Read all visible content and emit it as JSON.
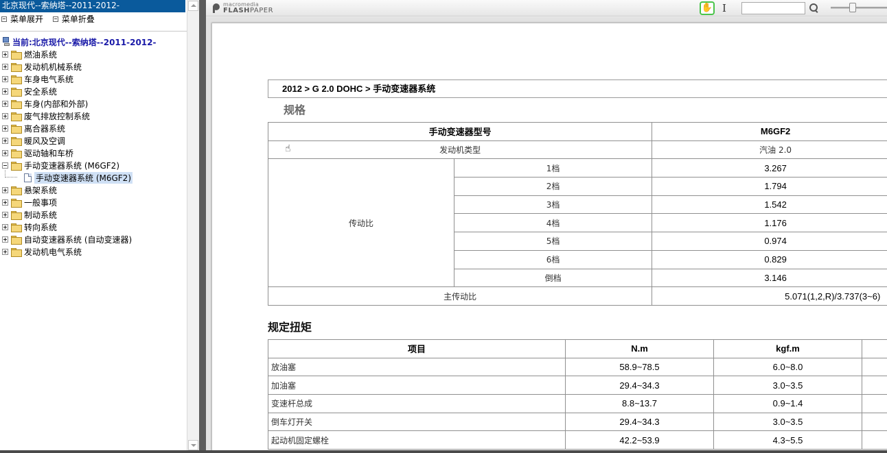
{
  "left": {
    "title": "北京现代--索纳塔--2011-2012-",
    "toolbar": {
      "expand_label": "菜单展开",
      "collapse_label": "菜单折叠"
    },
    "current": "当前:北京现代--索纳塔--2011-2012-",
    "tree": [
      "燃油系统",
      "发动机机械系统",
      "车身电气系统",
      "安全系统",
      "车身(内部和外部)",
      "废气排放控制系统",
      "离合器系统",
      "暖风及空调",
      "驱动轴和车桥",
      "手动变速器系统 (M6GF2)",
      "悬架系统",
      "一般事项",
      "制动系统",
      "转向系统",
      "自动变速器系统 (自动变速器)",
      "发动机电气系统"
    ],
    "selected_child": "手动变速器系统 (M6GF2)"
  },
  "toolbar": {
    "logo_small": "macromedia",
    "logo_big_a": "FLASH",
    "logo_big_b": "PAPER",
    "search_value": ""
  },
  "doc": {
    "breadcrumb": "2012 > G 2.0 DOHC > 手动变速器系统",
    "spec_heading": "规格",
    "spec": {
      "header_left": "手动变速器型号",
      "header_right": "M6GF2",
      "engine_label": "发动机类型",
      "engine_value": "汽油 2.0",
      "ratio_label": "传动比",
      "gears": [
        {
          "name": "1档",
          "value": "3.267"
        },
        {
          "name": "2档",
          "value": "1.794"
        },
        {
          "name": "3档",
          "value": "1.542"
        },
        {
          "name": "4档",
          "value": "1.176"
        },
        {
          "name": "5档",
          "value": "0.974"
        },
        {
          "name": "6档",
          "value": "0.829"
        },
        {
          "name": "倒档",
          "value": "3.146"
        }
      ],
      "final_label": "主传动比",
      "final_value": "5.071(1,2,R)/3.737(3~6)"
    },
    "torque_heading": "规定扭矩",
    "torque": {
      "headers": [
        "项目",
        "N.m",
        "kgf.m"
      ],
      "rows": [
        {
          "item": "放油塞",
          "nm": "58.9~78.5",
          "kgf": "6.0~8.0"
        },
        {
          "item": "加油塞",
          "nm": "29.4~34.3",
          "kgf": "3.0~3.5"
        },
        {
          "item": "变速杆总成",
          "nm": "8.8~13.7",
          "kgf": "0.9~1.4"
        },
        {
          "item": "倒车灯开关",
          "nm": "29.4~34.3",
          "kgf": "3.0~3.5"
        },
        {
          "item": "起动机固定螺栓",
          "nm": "42.2~53.9",
          "kgf": "4.3~5.5"
        }
      ]
    }
  }
}
